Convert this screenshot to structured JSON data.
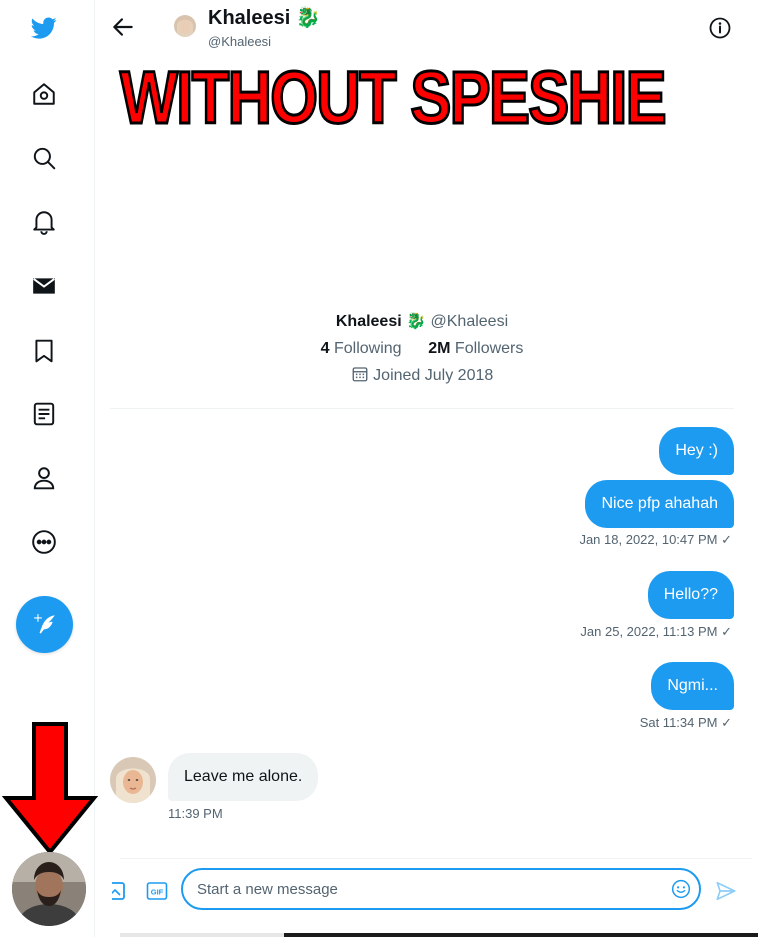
{
  "app": {
    "accent": "#1d9bf0"
  },
  "sidebar": {
    "items": [
      {
        "icon": "twitter-bird-icon",
        "label": ""
      },
      {
        "icon": "home-icon"
      },
      {
        "icon": "search-icon"
      },
      {
        "icon": "bell-icon"
      },
      {
        "icon": "mail-icon"
      },
      {
        "icon": "bookmark-icon"
      },
      {
        "icon": "lists-icon"
      },
      {
        "icon": "profile-icon"
      },
      {
        "icon": "more-icon"
      }
    ],
    "compose_icon": "feather-plus-icon"
  },
  "header": {
    "name": "Khaleesi",
    "emoji": "🐉",
    "handle": "@Khaleesi"
  },
  "overlay": {
    "text": "WITHOUT SPESHIE"
  },
  "profile": {
    "name": "Khaleesi",
    "emoji": "🐉",
    "handle": "@Khaleesi",
    "following_count": "4",
    "following_label": "Following",
    "followers_count": "2M",
    "followers_label": "Followers",
    "joined": "Joined July 2018"
  },
  "messages": [
    {
      "text": "Hey :)"
    },
    {
      "text": "Nice pfp ahahah",
      "meta": "Jan 18, 2022, 10:47 PM ✓"
    },
    {
      "text": "Hello??",
      "meta": "Jan 25, 2022, 11:13 PM ✓"
    },
    {
      "text": "Ngmi...",
      "meta": "Sat 11:34 PM ✓"
    },
    {
      "text": "Leave me alone.",
      "meta": "11:39 PM"
    }
  ],
  "composer": {
    "placeholder": "Start a new message",
    "gif_label": "GIF"
  }
}
